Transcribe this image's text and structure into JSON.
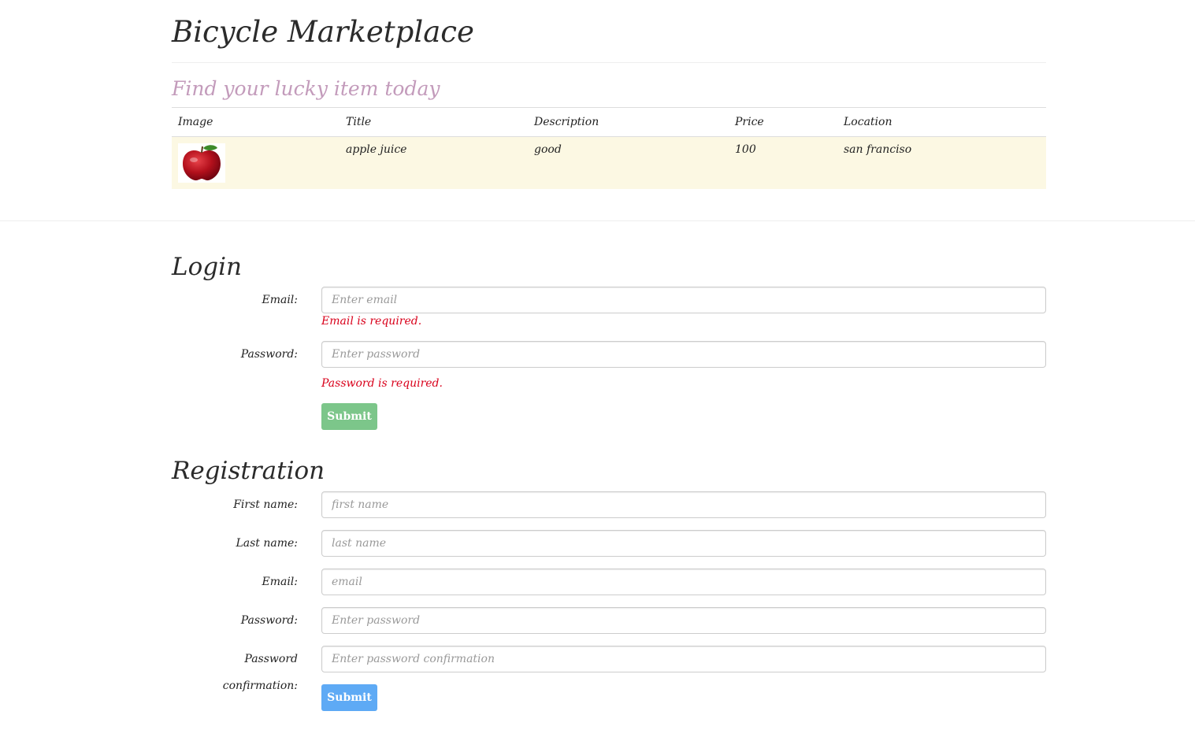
{
  "header": {
    "title": "Bicycle Marketplace",
    "tagline": "Find your lucky item today"
  },
  "listings": {
    "columns": [
      "Image",
      "Title",
      "Description",
      "Price",
      "Location"
    ],
    "rows": [
      {
        "image": "apple-image",
        "title": "apple juice",
        "description": "good",
        "price": "100",
        "location": "san franciso"
      }
    ]
  },
  "login": {
    "title": "Login",
    "email_label": "Email:",
    "email_placeholder": "Enter email",
    "email_error": "Email is required.",
    "password_label": "Password:",
    "password_placeholder": "Enter password",
    "password_error": "Password is required.",
    "submit_label": "Submit"
  },
  "registration": {
    "title": "Registration",
    "first_name_label": "First name:",
    "first_name_placeholder": "first name",
    "last_name_label": "Last name:",
    "last_name_placeholder": "last name",
    "email_label": "Email:",
    "email_placeholder": "email",
    "password_label": "Password:",
    "password_placeholder": "Enter password",
    "password_confirmation_label": "Password confirmation:",
    "password_confirmation_placeholder": "Enter password confirmation",
    "submit_label": "Submit"
  },
  "colors": {
    "tagline": "#c39bbb",
    "error": "#d9001b",
    "login_button": "#7cc68a",
    "register_button": "#5eaaf5",
    "row_highlight": "#fcf8e3"
  }
}
